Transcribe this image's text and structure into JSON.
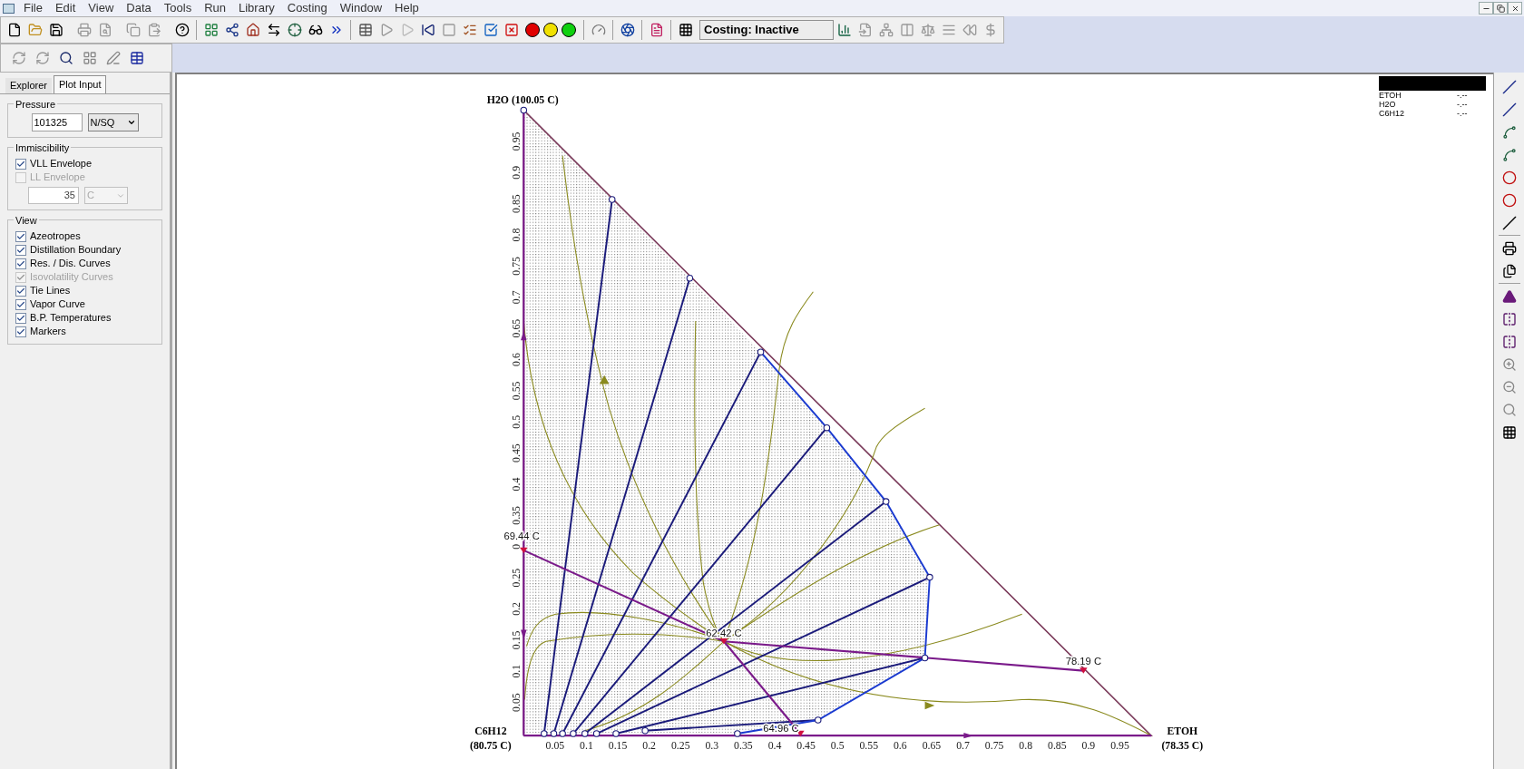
{
  "menu": [
    "File",
    "Edit",
    "View",
    "Data",
    "Tools",
    "Run",
    "Library",
    "Costing",
    "Window",
    "Help"
  ],
  "costing_status": "Costing: Inactive",
  "left_panel": {
    "tabs": [
      {
        "label": "Explorer",
        "selected": false
      },
      {
        "label": "Plot Input",
        "selected": true
      }
    ],
    "pressure": {
      "title": "Pressure",
      "value": "101325",
      "unit": "N/SQ"
    },
    "immiscibility": {
      "title": "Immiscibility",
      "options": [
        {
          "label": "VLL Envelope",
          "checked": true,
          "disabled": false
        },
        {
          "label": "LL Envelope",
          "checked": false,
          "disabled": true
        }
      ],
      "temperature": {
        "value": "35",
        "unit": "C",
        "disabled": true
      }
    },
    "view": {
      "title": "View",
      "options": [
        {
          "label": "Azeotropes",
          "checked": true,
          "disabled": false
        },
        {
          "label": "Distillation Boundary",
          "checked": true,
          "disabled": false
        },
        {
          "label": "Res. / Dis. Curves",
          "checked": true,
          "disabled": false
        },
        {
          "label": "Isovolatility Curves",
          "checked": true,
          "disabled": true
        },
        {
          "label": "Tie Lines",
          "checked": true,
          "disabled": false
        },
        {
          "label": "Vapor Curve",
          "checked": true,
          "disabled": false
        },
        {
          "label": "B.P. Temperatures",
          "checked": true,
          "disabled": false
        },
        {
          "label": "Markers",
          "checked": true,
          "disabled": false
        }
      ]
    }
  },
  "plot": {
    "vertex_top": [
      "H2O (100.05 C)"
    ],
    "vertex_left": [
      "C6H12",
      "(80.75 C)"
    ],
    "vertex_right": [
      "ETOH",
      "(78.35 C)"
    ],
    "y_ticks": [
      "0.05",
      "0.1",
      "0.15",
      "0.2",
      "0.25",
      "0",
      "0.35",
      "0.4",
      "0.45",
      "0.5",
      "0.55",
      "0.6",
      "0.65",
      "0.7",
      "0.75",
      "0.8",
      "0.85",
      "0.9",
      "0.95"
    ],
    "x_ticks": [
      "0.05",
      "0.1",
      "0.15",
      "0.2",
      "0.25",
      "0.3",
      "0.35",
      "0.4",
      "0.45",
      "0.5",
      "0.55",
      "0.6",
      "0.65",
      "0.7",
      "0.75",
      "0.8",
      "0.85",
      "0.9",
      "0.95"
    ],
    "azeotropes": [
      {
        "label": "69.44 C"
      },
      {
        "label": "62.42 C"
      },
      {
        "label": "78.19 C"
      },
      {
        "label": "64.96 C"
      }
    ],
    "legend": [
      {
        "component": "ETOH",
        "value": "-.--"
      },
      {
        "component": "H2O",
        "value": "-.--"
      },
      {
        "component": "C6H12",
        "value": "-.--"
      }
    ]
  }
}
